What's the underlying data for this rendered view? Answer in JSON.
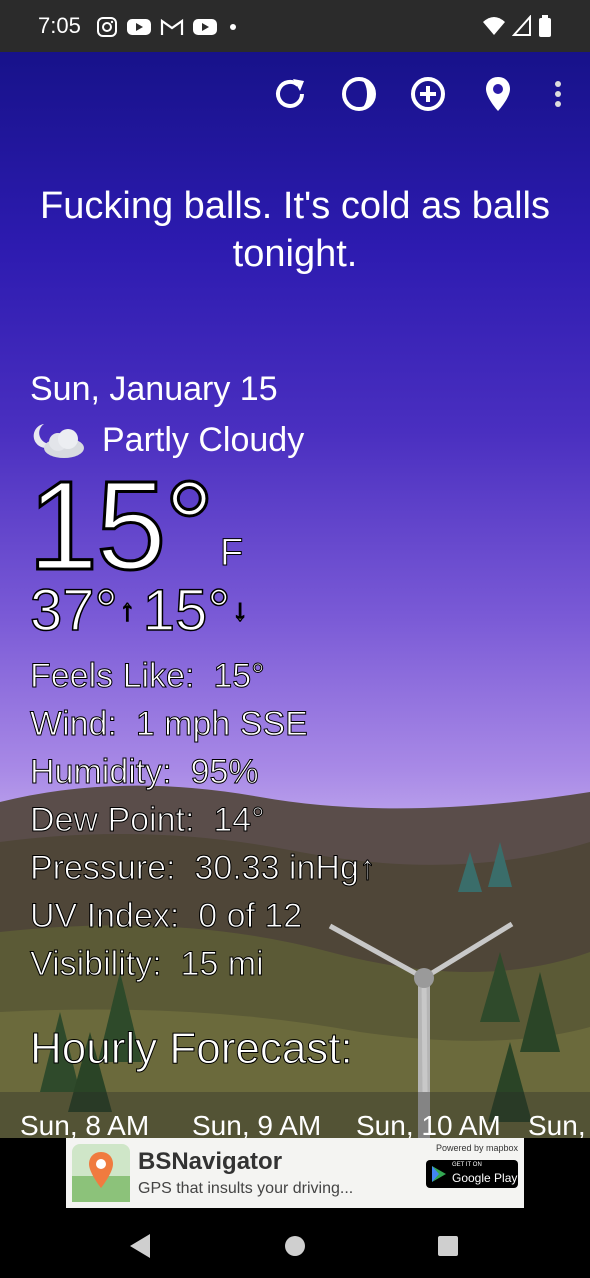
{
  "status_bar": {
    "time": "7:05",
    "left_icons": [
      "instagram-icon",
      "youtube-icon",
      "gmail-icon",
      "youtube-icon",
      "dot-icon"
    ],
    "right_icons": [
      "wifi-icon",
      "signal-icon",
      "battery-icon"
    ]
  },
  "toolbar": {
    "icons": [
      "refresh-icon",
      "moon-phase-icon",
      "add-location-icon",
      "location-pin-icon",
      "more-vert-icon"
    ]
  },
  "quip": "Fucking balls. It's cold as balls tonight.",
  "current": {
    "date": "Sun, January 15",
    "condition_icon": "partly-cloudy-night-icon",
    "condition": "Partly Cloudy",
    "temp": "15°",
    "unit": "F",
    "high": "37°",
    "low": "15°",
    "high_arrow": "↑",
    "low_arrow": "↓"
  },
  "details": [
    {
      "label": "Feels Like:",
      "value": "15°"
    },
    {
      "label": "Wind:",
      "value": "1 mph SSE"
    },
    {
      "label": "Humidity:",
      "value": "95%"
    },
    {
      "label": "Dew Point:",
      "value": "14°"
    },
    {
      "label": "Pressure:",
      "value": "30.33 inHg↑"
    },
    {
      "label": "UV Index:",
      "value": "0 of 12"
    },
    {
      "label": "Visibility:",
      "value": "15 mi"
    }
  ],
  "hourly": {
    "title": "Hourly Forecast:",
    "hours": [
      "Sun, 8 AM",
      "Sun, 9 AM",
      "Sun, 10 AM",
      "Sun,"
    ]
  },
  "ad": {
    "title": "BSNavigator",
    "subtitle": "GPS that insults your driving...",
    "powered_by": "Powered by mapbox",
    "store_top": "GET IT ON",
    "store_name": "Google Play"
  },
  "nav_bar": {
    "buttons": [
      "back-icon",
      "home-icon",
      "recents-icon"
    ]
  }
}
